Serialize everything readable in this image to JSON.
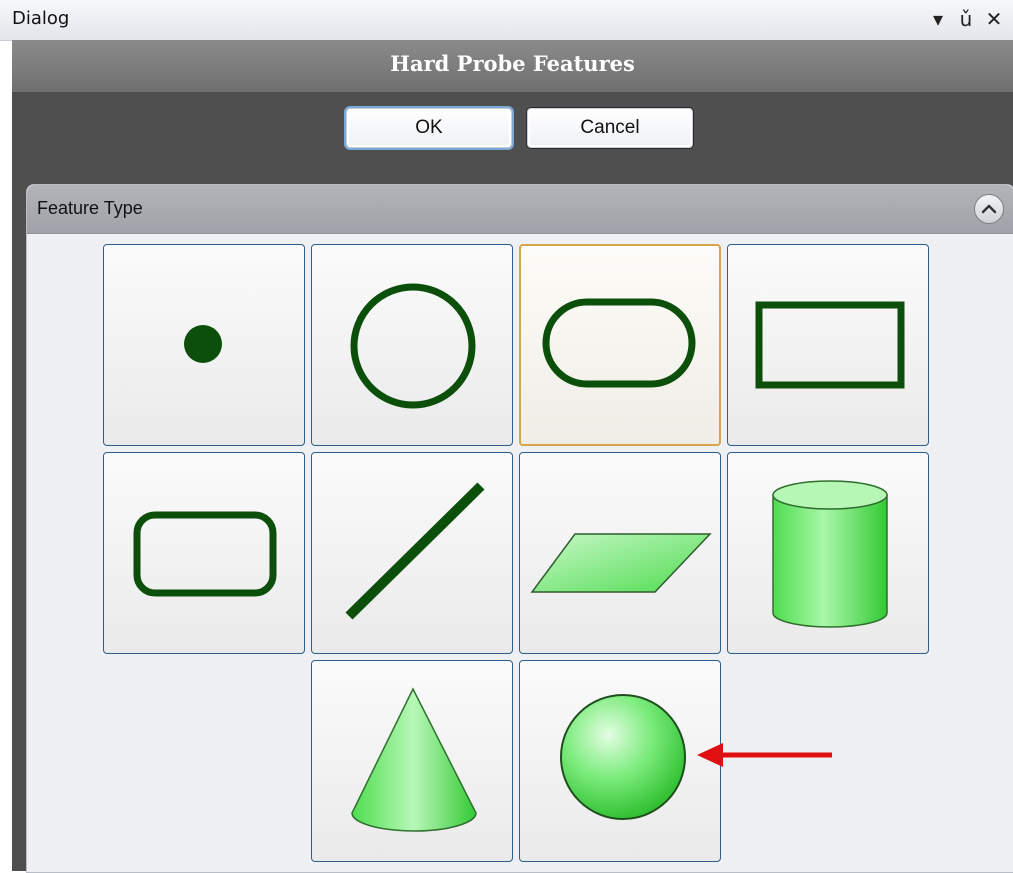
{
  "window": {
    "title": "Dialog",
    "controls": [
      "dropdown-arrow-icon",
      "pin-icon",
      "close-icon"
    ]
  },
  "dialog": {
    "title": "Hard Probe Features",
    "ok_label": "OK",
    "cancel_label": "Cancel"
  },
  "panel": {
    "label": "Feature Type",
    "collapse_icon": "chevron-up-icon",
    "selected_feature": "slot",
    "features": [
      {
        "id": "point",
        "icon": "point-icon"
      },
      {
        "id": "circle",
        "icon": "circle-icon"
      },
      {
        "id": "slot",
        "icon": "slot-icon"
      },
      {
        "id": "rectangle",
        "icon": "rectangle-icon"
      },
      {
        "id": "rounded-rectangle",
        "icon": "rounded-rectangle-icon"
      },
      {
        "id": "line",
        "icon": "line-icon"
      },
      {
        "id": "plane",
        "icon": "plane-icon"
      },
      {
        "id": "cylinder",
        "icon": "cylinder-icon"
      },
      {
        "id": "cone",
        "icon": "cone-icon"
      },
      {
        "id": "sphere",
        "icon": "sphere-icon"
      }
    ]
  },
  "annotation": {
    "icon": "red-arrow-icon",
    "color": "#e01010"
  },
  "colors": {
    "feature_stroke": "#0b4f0b",
    "feature_fill": "#6fe86f",
    "selected_border": "#d8a44a"
  }
}
